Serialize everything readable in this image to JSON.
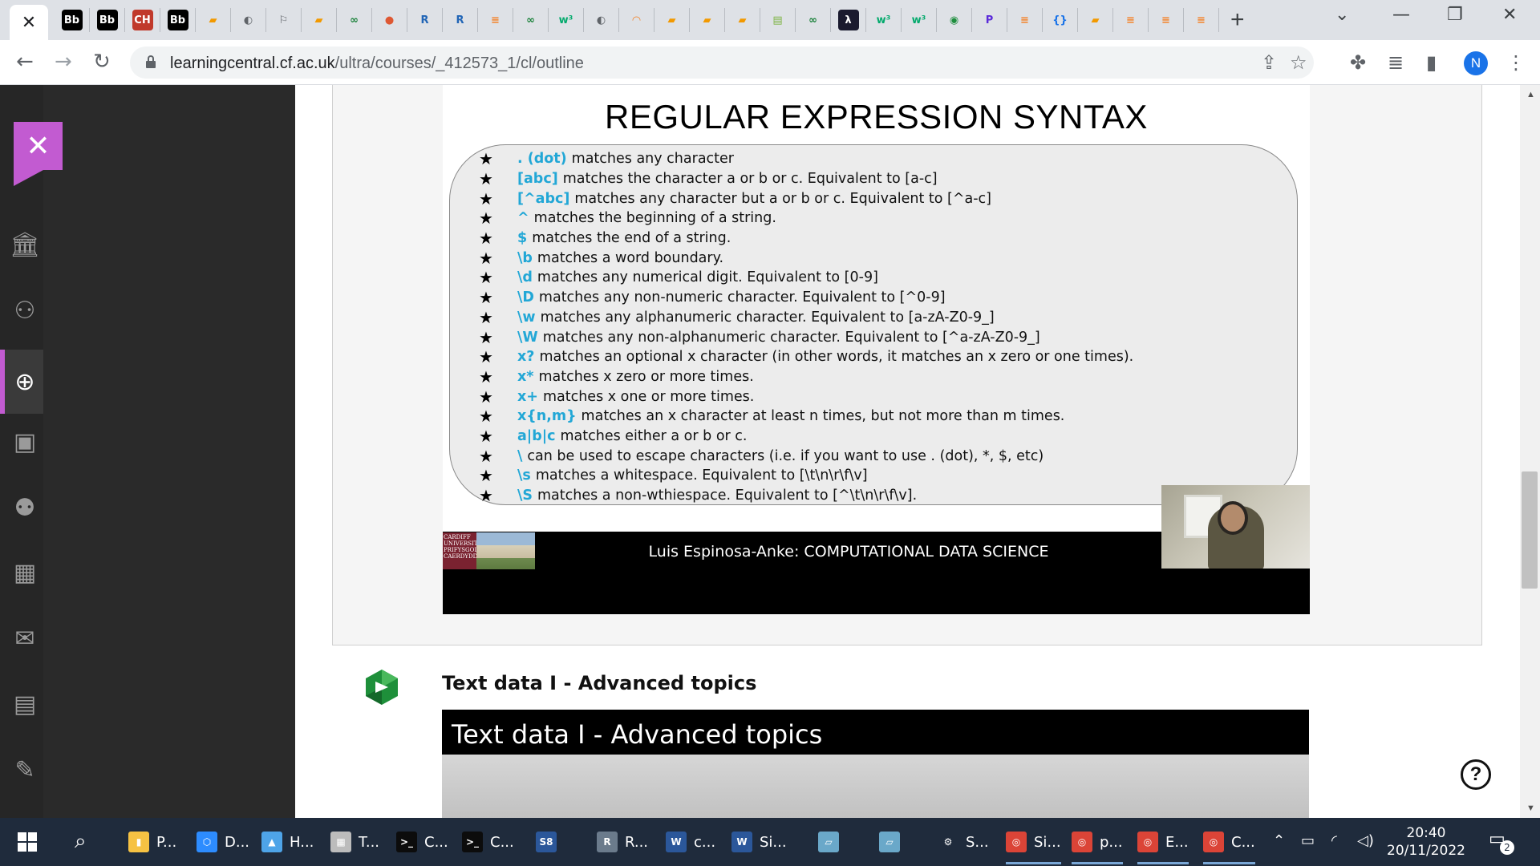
{
  "browser": {
    "active_tab_close": "✕",
    "tab_favicons": [
      {
        "icon": "blackboard-icon",
        "glyph": "Bb",
        "bg": "#000000",
        "fg": "#ffffff"
      },
      {
        "icon": "blackboard-icon",
        "glyph": "Bb",
        "bg": "#000000",
        "fg": "#ffffff"
      },
      {
        "icon": "chemistry-icon",
        "glyph": "CH",
        "bg": "#c0392b",
        "fg": "#ffffff"
      },
      {
        "icon": "blackboard-icon",
        "glyph": "Bb",
        "bg": "#000000",
        "fg": "#ffffff"
      },
      {
        "icon": "book-icon",
        "glyph": "▰",
        "bg": "#dee1e6",
        "fg": "#f29900"
      },
      {
        "icon": "globe-icon",
        "glyph": "◐",
        "bg": "#dee1e6",
        "fg": "#5f6368"
      },
      {
        "icon": "flag-icon",
        "glyph": "⚐",
        "bg": "#dee1e6",
        "fg": "#5f6368"
      },
      {
        "icon": "book-icon",
        "glyph": "▰",
        "bg": "#dee1e6",
        "fg": "#f29900"
      },
      {
        "icon": "infinity-icon",
        "glyph": "∞",
        "bg": "#dee1e6",
        "fg": "#188038"
      },
      {
        "icon": "duckduckgo-icon",
        "glyph": "●",
        "bg": "#dee1e6",
        "fg": "#de5833"
      },
      {
        "icon": "r-icon",
        "glyph": "R",
        "bg": "#dee1e6",
        "fg": "#2165b6"
      },
      {
        "icon": "r-icon",
        "glyph": "R",
        "bg": "#dee1e6",
        "fg": "#2165b6"
      },
      {
        "icon": "stack-icon",
        "glyph": "≡",
        "bg": "#dee1e6",
        "fg": "#f48024"
      },
      {
        "icon": "infinity-icon",
        "glyph": "∞",
        "bg": "#dee1e6",
        "fg": "#188038"
      },
      {
        "icon": "w3schools-icon",
        "glyph": "w³",
        "bg": "#dee1e6",
        "fg": "#04aa6d"
      },
      {
        "icon": "globe-icon",
        "glyph": "◐",
        "bg": "#dee1e6",
        "fg": "#5f6368"
      },
      {
        "icon": "loading-icon",
        "glyph": "◠",
        "bg": "#dee1e6",
        "fg": "#f48024"
      },
      {
        "icon": "book-icon",
        "glyph": "▰",
        "bg": "#dee1e6",
        "fg": "#f29900"
      },
      {
        "icon": "book-icon",
        "glyph": "▰",
        "bg": "#dee1e6",
        "fg": "#f29900"
      },
      {
        "icon": "book-icon",
        "glyph": "▰",
        "bg": "#dee1e6",
        "fg": "#f29900"
      },
      {
        "icon": "notes-icon",
        "glyph": "▤",
        "bg": "#dee1e6",
        "fg": "#7cb342"
      },
      {
        "icon": "infinity-icon",
        "glyph": "∞",
        "bg": "#dee1e6",
        "fg": "#188038"
      },
      {
        "icon": "lambda-icon",
        "glyph": "λ",
        "bg": "#1a1a2e",
        "fg": "#ffffff"
      },
      {
        "icon": "w3schools-icon",
        "glyph": "w³",
        "bg": "#dee1e6",
        "fg": "#04aa6d"
      },
      {
        "icon": "w3schools-icon",
        "glyph": "w³",
        "bg": "#dee1e6",
        "fg": "#04aa6d"
      },
      {
        "icon": "swirl-icon",
        "glyph": "◉",
        "bg": "#dee1e6",
        "fg": "#1e8e3e"
      },
      {
        "icon": "p-icon",
        "glyph": "P",
        "bg": "#dee1e6",
        "fg": "#5b2bd9"
      },
      {
        "icon": "stack-icon",
        "glyph": "≡",
        "bg": "#dee1e6",
        "fg": "#f48024"
      },
      {
        "icon": "braces-icon",
        "glyph": "{}",
        "bg": "#dee1e6",
        "fg": "#1a73e8"
      },
      {
        "icon": "book-icon",
        "glyph": "▰",
        "bg": "#dee1e6",
        "fg": "#f29900"
      },
      {
        "icon": "stack-icon",
        "glyph": "≡",
        "bg": "#dee1e6",
        "fg": "#f48024"
      },
      {
        "icon": "stack-icon",
        "glyph": "≡",
        "bg": "#dee1e6",
        "fg": "#f48024"
      },
      {
        "icon": "stack-icon",
        "glyph": "≡",
        "bg": "#dee1e6",
        "fg": "#f48024"
      }
    ],
    "new_tab": "+",
    "url_domain": "learningcentral.cf.ac.uk",
    "url_path": "/ultra/courses/_412573_1/cl/outline",
    "profile_initial": "N"
  },
  "slide": {
    "title": "REGULAR EXPRESSION SYNTAX",
    "rules": [
      {
        "token": ". (dot)",
        "text": "matches any character"
      },
      {
        "token": "[abc]",
        "text": "matches the character a or b or c. Equivalent to [a-c]"
      },
      {
        "token": "[^abc]",
        "text": "matches any character but a or b or c. Equivalent to [^a-c]"
      },
      {
        "token": "^",
        "text": "matches the beginning of a string."
      },
      {
        "token": "$",
        "text": "matches the end of a string."
      },
      {
        "token": "\\b",
        "text": "matches a word boundary."
      },
      {
        "token": "\\d",
        "text": "matches any numerical digit. Equivalent to [0-9]"
      },
      {
        "token": "\\D",
        "text": "matches any non-numeric character. Equivalent to [^0-9]"
      },
      {
        "token": "\\w",
        "text": "matches any alphanumeric character. Equivalent to [a-zA-Z0-9_]"
      },
      {
        "token": "\\W",
        "text": "matches any non-alphanumeric character. Equivalent to [^a-zA-Z0-9_]"
      },
      {
        "token": "x?",
        "text": "matches an optional x character (in other words, it matches an x zero or one times)."
      },
      {
        "token": "x*",
        "text": "matches x zero or more times."
      },
      {
        "token": "x+",
        "text": "matches x one or more times."
      },
      {
        "token": "x{n,m}",
        "text": "matches an x character at least n times, but not more than m times."
      },
      {
        "token": "a|b|c",
        "text": "matches either a or b or c."
      },
      {
        "token": "\\",
        "text": "can be used to escape characters (i.e. if you want to use . (dot), *, $, etc)"
      },
      {
        "token": "\\s",
        "text": "matches a whitespace. Equivalent to [\\t\\n\\r\\f\\v]"
      },
      {
        "token": "\\S",
        "text": "matches a non-wthiespace. Equivalent to [^\\t\\n\\r\\f\\v]."
      }
    ],
    "logo_text": "CARDIFF UNIVERSITY PRIFYSGOL CAERDYDD",
    "footer": "Luis Espinosa-Anke: COMPUTATIONAL DATA SCIENCE"
  },
  "next_item": {
    "title": "Text data I - Advanced topics",
    "video_title": "Text data I - Advanced topics"
  },
  "help_glyph": "?",
  "taskbar": {
    "apps": [
      {
        "icon": "file-explorer-icon",
        "glyph": "▮",
        "color": "#f6c243",
        "label": "P..."
      },
      {
        "icon": "cube-icon",
        "glyph": "⬡",
        "color": "#2d8cff",
        "label": "D..."
      },
      {
        "icon": "photos-icon",
        "glyph": "▲",
        "color": "#4ea4e8",
        "label": "H..."
      },
      {
        "icon": "presentation-icon",
        "glyph": "▦",
        "color": "#bcbcbc",
        "label": "T..."
      },
      {
        "icon": "terminal-icon",
        "glyph": ">_",
        "color": "#0c0c0c",
        "label": "C..."
      },
      {
        "icon": "terminal-icon",
        "glyph": ">_",
        "color": "#0c0c0c",
        "label": "C..."
      },
      {
        "icon": "s8-icon",
        "glyph": "S8",
        "color": "#2b579a",
        "label": ""
      },
      {
        "icon": "r-icon",
        "glyph": "R",
        "color": "#6b7b8c",
        "label": "R..."
      },
      {
        "icon": "word-icon",
        "glyph": "W",
        "color": "#2b579a",
        "label": "c..."
      },
      {
        "icon": "word-icon",
        "glyph": "W",
        "color": "#2b579a",
        "label": "Si..."
      },
      {
        "icon": "notebook-icon",
        "glyph": "▱",
        "color": "#6aa8c9",
        "label": ""
      },
      {
        "icon": "notebook-icon",
        "glyph": "▱",
        "color": "#6aa8c9",
        "label": ""
      },
      {
        "icon": "settings-icon",
        "glyph": "⚙",
        "color": "#1f2b3c",
        "label": "S..."
      },
      {
        "icon": "chrome-icon",
        "glyph": "◎",
        "color": "#db4437",
        "label": "Si..."
      },
      {
        "icon": "chrome-icon",
        "glyph": "◎",
        "color": "#db4437",
        "label": "p..."
      },
      {
        "icon": "chrome-icon",
        "glyph": "◎",
        "color": "#db4437",
        "label": "E..."
      },
      {
        "icon": "chrome-icon",
        "glyph": "◎",
        "color": "#db4437",
        "label": "C..."
      }
    ],
    "time": "20:40",
    "date": "20/11/2022",
    "notification_count": "2"
  }
}
